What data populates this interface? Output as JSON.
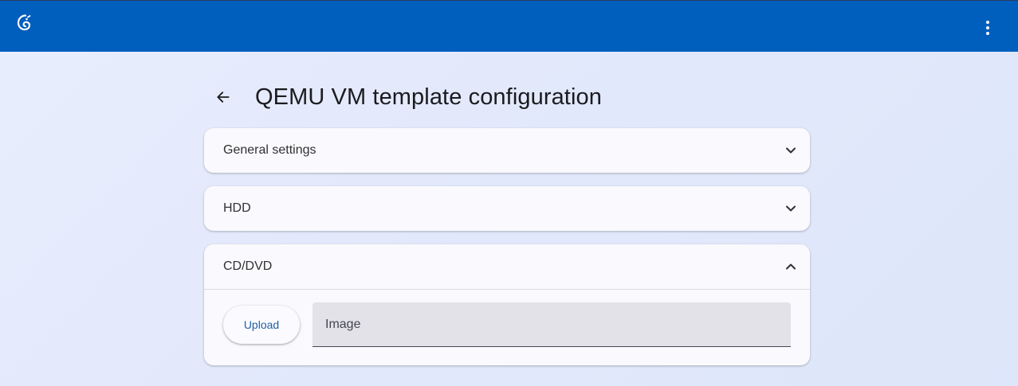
{
  "topbar": {
    "logo_icon": "chameleon-logo-icon",
    "menu_icon": "more-vert-icon",
    "color": "#005ebd"
  },
  "header": {
    "back_icon": "arrow-back-icon",
    "title": "QEMU VM template configuration"
  },
  "panels": [
    {
      "title": "General settings",
      "expanded": false,
      "chevron_icon": "chevron-down-icon"
    },
    {
      "title": "HDD",
      "expanded": false,
      "chevron_icon": "chevron-down-icon"
    },
    {
      "title": "CD/DVD",
      "expanded": true,
      "chevron_icon": "chevron-up-icon"
    }
  ],
  "cd_dvd": {
    "upload_label": "Upload",
    "image_field_label": "Image",
    "image_field_value": ""
  }
}
